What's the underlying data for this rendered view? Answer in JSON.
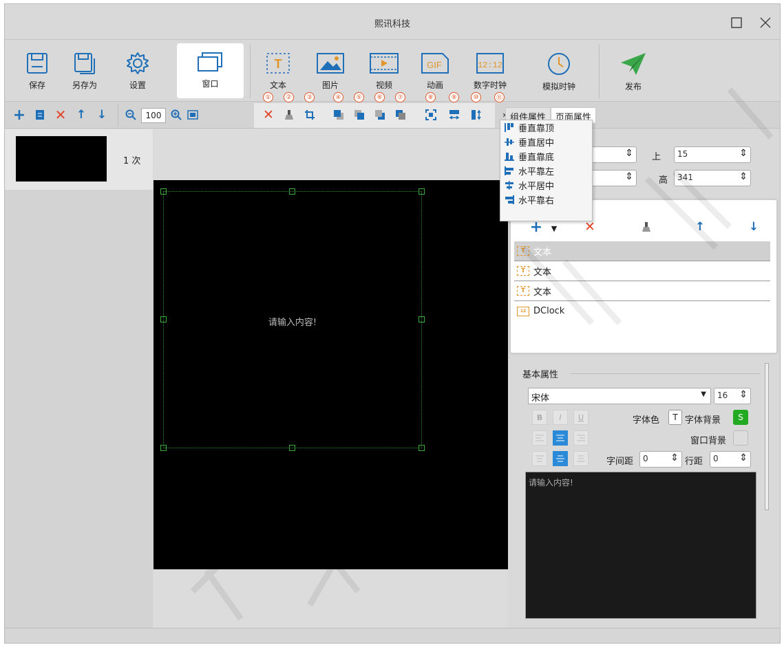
{
  "window": {
    "title": "熙讯科技"
  },
  "toolbar": {
    "save": "保存",
    "save_as": "另存为",
    "settings": "设置",
    "window": "窗口",
    "text": "文本",
    "picture": "图片",
    "video": "视频",
    "animation": "动画",
    "digital_clock": "数字时钟",
    "analog_clock": "模拟时钟",
    "publish": "发布",
    "gif_label": "GIF",
    "clock_digits": "12:12"
  },
  "zoom": {
    "value": "100"
  },
  "badges": [
    "①",
    "②",
    "③",
    "④",
    "⑤",
    "⑥",
    "⑦",
    "⑧",
    "⑨",
    "⑩",
    "⑪"
  ],
  "program_list": {
    "count_label": "1 次"
  },
  "canvas": {
    "placeholder": "请输入内容!"
  },
  "tabs": {
    "component": "组件属性",
    "page": "页面属性",
    "more": "»"
  },
  "align_menu": [
    "垂直靠顶",
    "垂直居中",
    "垂直靠底",
    "水平靠左",
    "水平居中",
    "水平靠右"
  ],
  "position": {
    "top_label": "上",
    "top_value": "15",
    "height_label": "高",
    "height_value": "341"
  },
  "layers": [
    {
      "name": "文本",
      "type": "text"
    },
    {
      "name": "文本",
      "type": "text"
    },
    {
      "name": "文本",
      "type": "text"
    },
    {
      "name": "DClock",
      "type": "clock"
    }
  ],
  "properties": {
    "title": "基本属性",
    "font": "宋体",
    "font_size": "16",
    "bold": "B",
    "italic": "I",
    "underline": "U",
    "font_color": "字体色",
    "font_color_btn": "T",
    "font_bg": "字体背景",
    "font_bg_btn": "S",
    "window_bg": "窗口背景",
    "char_spacing": "字间距",
    "char_spacing_value": "0",
    "line_spacing": "行距",
    "line_spacing_value": "0",
    "content": "请输入内容!"
  },
  "colors": {
    "accent": "#2a8ad8",
    "delete": "#e2442a",
    "icon_blue": "#1e6fb8",
    "publish": "#3aa84a",
    "badge": "#e2572a"
  }
}
